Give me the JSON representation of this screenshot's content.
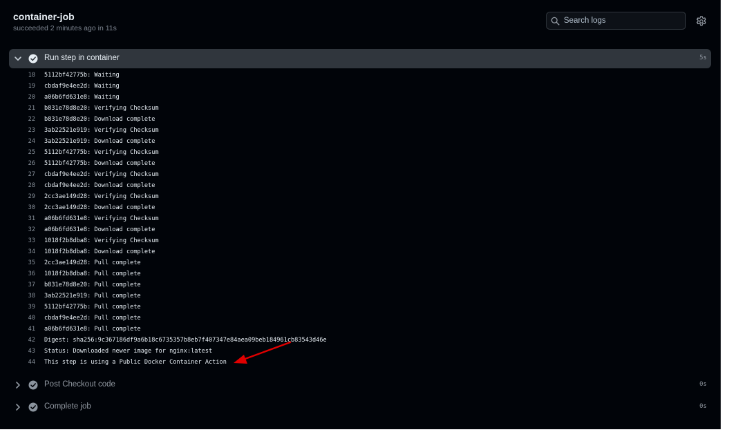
{
  "job": {
    "title": "container-job",
    "status": "succeeded",
    "time_ago": "2 minutes ago",
    "duration_prefix": "in",
    "duration": "11s"
  },
  "search": {
    "placeholder": "Search logs"
  },
  "icons": {
    "search": "search-icon",
    "settings": "gear-icon",
    "expanded": "chevron-down-icon",
    "collapsed": "chevron-right-icon",
    "success": "check-circle-icon"
  },
  "colors": {
    "background": "#010409",
    "active_step": "#30363d",
    "success_check": "#e6edf3",
    "annotation_arrow": "#e00000"
  },
  "steps": [
    {
      "name": "Run step in container",
      "duration": "5s",
      "expanded": true
    },
    {
      "name": "Post Checkout code",
      "duration": "0s",
      "expanded": false
    },
    {
      "name": "Complete job",
      "duration": "0s",
      "expanded": false
    }
  ],
  "log_lines": [
    {
      "n": "18",
      "text": "5112bf42775b: Waiting"
    },
    {
      "n": "19",
      "text": "cbdaf9e4ee2d: Waiting"
    },
    {
      "n": "20",
      "text": "a06b6fd631e8: Waiting"
    },
    {
      "n": "21",
      "text": "b831e78d8e20: Verifying Checksum"
    },
    {
      "n": "22",
      "text": "b831e78d8e20: Download complete"
    },
    {
      "n": "23",
      "text": "3ab22521e919: Verifying Checksum"
    },
    {
      "n": "24",
      "text": "3ab22521e919: Download complete"
    },
    {
      "n": "25",
      "text": "5112bf42775b: Verifying Checksum"
    },
    {
      "n": "26",
      "text": "5112bf42775b: Download complete"
    },
    {
      "n": "27",
      "text": "cbdaf9e4ee2d: Verifying Checksum"
    },
    {
      "n": "28",
      "text": "cbdaf9e4ee2d: Download complete"
    },
    {
      "n": "29",
      "text": "2cc3ae149d28: Verifying Checksum"
    },
    {
      "n": "30",
      "text": "2cc3ae149d28: Download complete"
    },
    {
      "n": "31",
      "text": "a06b6fd631e8: Verifying Checksum"
    },
    {
      "n": "32",
      "text": "a06b6fd631e8: Download complete"
    },
    {
      "n": "33",
      "text": "1018f2b8dba8: Verifying Checksum"
    },
    {
      "n": "34",
      "text": "1018f2b8dba8: Download complete"
    },
    {
      "n": "35",
      "text": "2cc3ae149d28: Pull complete"
    },
    {
      "n": "36",
      "text": "1018f2b8dba8: Pull complete"
    },
    {
      "n": "37",
      "text": "b831e78d8e20: Pull complete"
    },
    {
      "n": "38",
      "text": "3ab22521e919: Pull complete"
    },
    {
      "n": "39",
      "text": "5112bf42775b: Pull complete"
    },
    {
      "n": "40",
      "text": "cbdaf9e4ee2d: Pull complete"
    },
    {
      "n": "41",
      "text": "a06b6fd631e8: Pull complete"
    },
    {
      "n": "42",
      "text": "Digest: sha256:9c367186df9a6b18c6735357b8eb7f407347e84aea09beb184961cb83543d46e"
    },
    {
      "n": "43",
      "text": "Status: Downloaded newer image for nginx:latest"
    },
    {
      "n": "44",
      "text": "This step is using a Public Docker Container Action"
    }
  ]
}
